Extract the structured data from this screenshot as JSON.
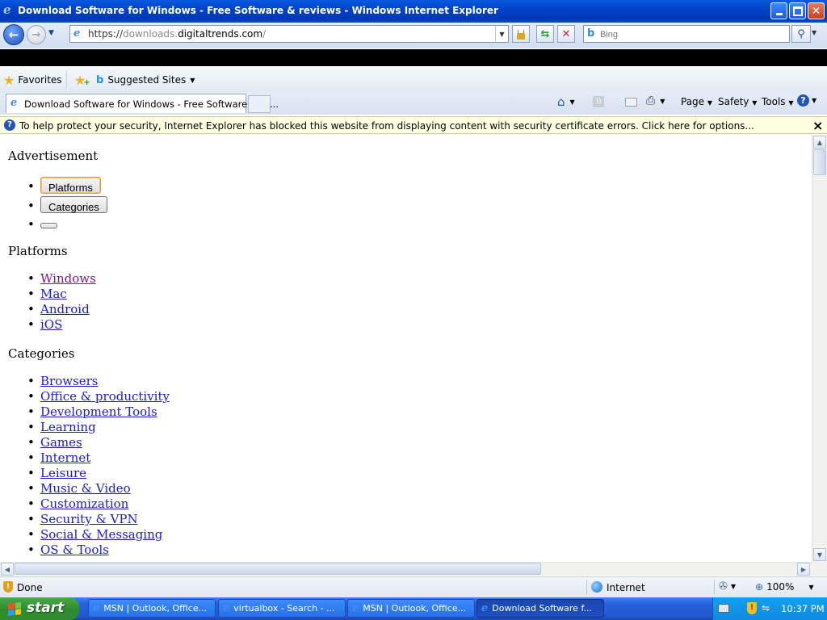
{
  "window": {
    "title": "Download Software for Windows - Free Software & reviews - Windows Internet Explorer"
  },
  "address_bar": {
    "url_prefix": "https://",
    "url_sub": "downloads.",
    "url_domain": "digitaltrends.com",
    "url_suffix": "/"
  },
  "search_box": {
    "placeholder": "Bing"
  },
  "favorites_bar": {
    "favorites_label": "Favorites",
    "suggested_label": "Suggested Sites"
  },
  "tab": {
    "title": "Download Software for Windows - Free Software & re..."
  },
  "command_bar": {
    "page_label": "Page",
    "safety_label": "Safety",
    "tools_label": "Tools"
  },
  "info_bar": {
    "message": "To help protect your security, Internet Explorer has blocked this website from displaying content with security certificate errors. Click here for options...",
    "close": "×"
  },
  "page": {
    "advertisement": "Advertisement",
    "buttons": [
      "Platforms",
      "Categories"
    ],
    "platforms_heading": "Platforms",
    "platforms": [
      "Windows",
      "Mac",
      "Android",
      "iOS"
    ],
    "categories_heading": "Categories",
    "categories": [
      "Browsers",
      "Office & productivity",
      "Development Tools",
      "Learning",
      "Games",
      "Internet",
      "Leisure",
      "Music & Video",
      "Customization",
      "Security & VPN",
      "Social & Messaging",
      "OS & Tools"
    ]
  },
  "status_bar": {
    "status": "Done",
    "zone": "Internet",
    "zoom": "100%"
  },
  "taskbar": {
    "start_label": "start",
    "tasks": [
      "MSN | Outlook, Office...",
      "virtualbox - Search - ...",
      "MSN | Outlook, Office...",
      "Download Software f..."
    ],
    "clock": "10:37 PM"
  },
  "colors": {
    "link": "#1a1acc",
    "visited_link": "#7a1a8a",
    "info_bar": "#ffffe1",
    "titlebar": "#0242c8",
    "taskbar": "#2458d0"
  }
}
